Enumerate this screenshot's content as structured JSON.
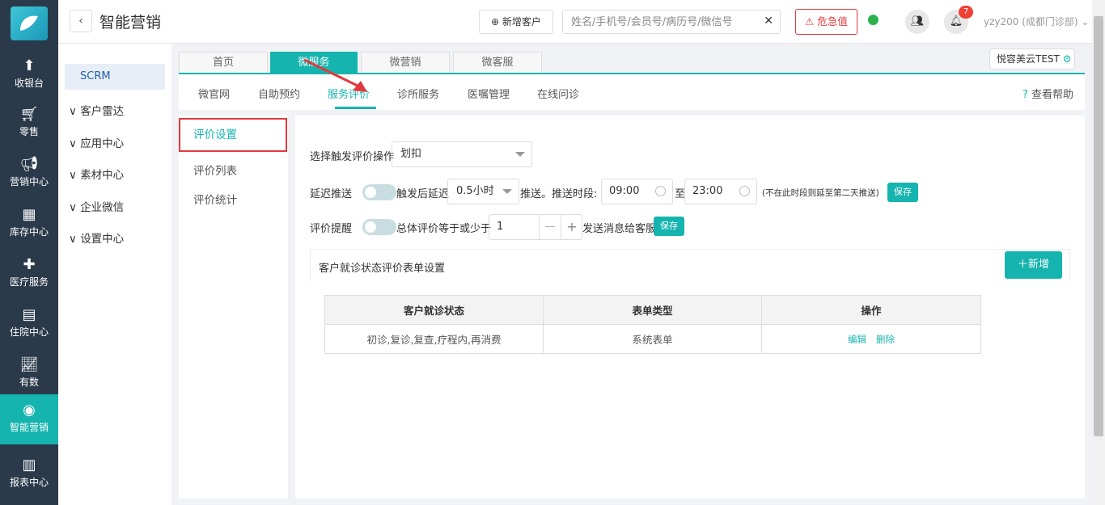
{
  "app": {
    "title": "智能营销"
  },
  "leftnav": {
    "items": [
      {
        "label": "收银台",
        "icon": "cashier-icon"
      },
      {
        "label": "零售",
        "icon": "cart-icon"
      },
      {
        "label": "营销中心",
        "icon": "megaphone-icon"
      },
      {
        "label": "库存中心",
        "icon": "grid-icon"
      },
      {
        "label": "医疗服务",
        "icon": "medkit-icon"
      },
      {
        "label": "住院中心",
        "icon": "building-icon"
      },
      {
        "label": "有数",
        "icon": "trend-icon"
      },
      {
        "label": "智能营销",
        "icon": "marketing-icon",
        "active": true
      },
      {
        "label": "报表中心",
        "icon": "chart-icon"
      }
    ]
  },
  "topbar": {
    "new_customer": "新增客户",
    "search_placeholder": "姓名/手机号/会员号/病历号/微信号",
    "critical": "危急值",
    "badge_count": "7",
    "user": "yzy200 (成都门诊部)"
  },
  "sidebar": {
    "scrm": "SCRM",
    "items": [
      "客户雷达",
      "应用中心",
      "素材中心",
      "企业微信",
      "设置中心"
    ]
  },
  "top_tabs": [
    "首页",
    "微服务",
    "微营销",
    "微客服"
  ],
  "subnav": [
    "微官网",
    "自助预约",
    "服务评价",
    "诊所服务",
    "医嘱管理",
    "在线问诊"
  ],
  "store_tag": "悦容美云TEST",
  "help": "查看帮助",
  "left_menu": [
    "评价设置",
    "评价列表",
    "评价统计"
  ],
  "form": {
    "trigger_label": "选择触发评价操作",
    "trigger_value": "划扣",
    "delay_label": "延迟推送",
    "delay_prefix": "触发后延迟",
    "delay_value": "0.5小时",
    "delay_suffix": "推送。推送时段:",
    "time_start": "09:00",
    "time_to": "至",
    "time_end": "23:00",
    "time_note": "(不在此时段则延至第二天推送)",
    "save": "保存",
    "reminder_label": "评价提醒",
    "reminder_prefix": "总体评价等于或少于",
    "reminder_value": "1",
    "reminder_suffix": "发送消息给客服",
    "section_title": "客户就诊状态评价表单设置",
    "add": "新增"
  },
  "table": {
    "headers": [
      "客户就诊状态",
      "表单类型",
      "操作"
    ],
    "rows": [
      {
        "status": "初诊,复诊,复查,疗程内,再消费",
        "type": "系统表单",
        "edit": "编辑",
        "delete": "删除"
      }
    ]
  },
  "colors": {
    "accent": "#16b4ae",
    "danger": "#e0393e",
    "nav": "#2a3a4b"
  }
}
